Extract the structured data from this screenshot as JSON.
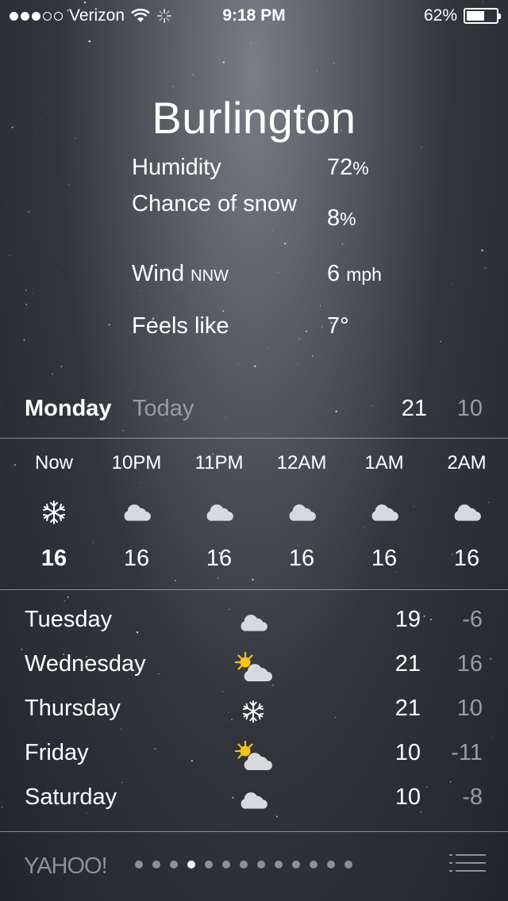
{
  "status_bar": {
    "carrier": "Verizon",
    "signal_dots_filled": 3,
    "signal_dots_total": 5,
    "time": "9:18 PM",
    "battery_percent": "62%",
    "battery_level": 0.62
  },
  "current": {
    "city": "Burlington",
    "details": [
      {
        "label": "Humidity",
        "value": "72",
        "unit": "%"
      },
      {
        "label": "Chance of snow",
        "value": "8",
        "unit": "%"
      },
      {
        "label": "Wind",
        "label_suffix": "NNW",
        "value": "6",
        "unit": "mph"
      },
      {
        "label": "Feels like",
        "value": "7°",
        "unit": ""
      }
    ]
  },
  "today": {
    "day": "Monday",
    "tag": "Today",
    "high": "21",
    "low": "10"
  },
  "hourly": [
    {
      "time": "Now",
      "icon": "snowflake-icon",
      "temp": "16"
    },
    {
      "time": "10PM",
      "icon": "cloud-icon",
      "temp": "16"
    },
    {
      "time": "11PM",
      "icon": "cloud-icon",
      "temp": "16"
    },
    {
      "time": "12AM",
      "icon": "cloud-icon",
      "temp": "16"
    },
    {
      "time": "1AM",
      "icon": "cloud-icon",
      "temp": "16"
    },
    {
      "time": "2AM",
      "icon": "cloud-icon",
      "temp": "16"
    }
  ],
  "daily": [
    {
      "day": "Tuesday",
      "icon": "cloud-icon",
      "high": "19",
      "low": "-6"
    },
    {
      "day": "Wednesday",
      "icon": "partly-sunny-icon",
      "high": "21",
      "low": "16"
    },
    {
      "day": "Thursday",
      "icon": "snowflake-icon",
      "high": "21",
      "low": "10"
    },
    {
      "day": "Friday",
      "icon": "partly-sunny-icon",
      "high": "10",
      "low": "-11"
    },
    {
      "day": "Saturday",
      "icon": "cloud-icon",
      "high": "10",
      "low": "-8"
    }
  ],
  "footer": {
    "brand": "YAHOO!",
    "pages_total": 13,
    "current_page": 4
  },
  "colors": {
    "sun": "#f5c518",
    "muted_text": "#9a9ca5"
  }
}
